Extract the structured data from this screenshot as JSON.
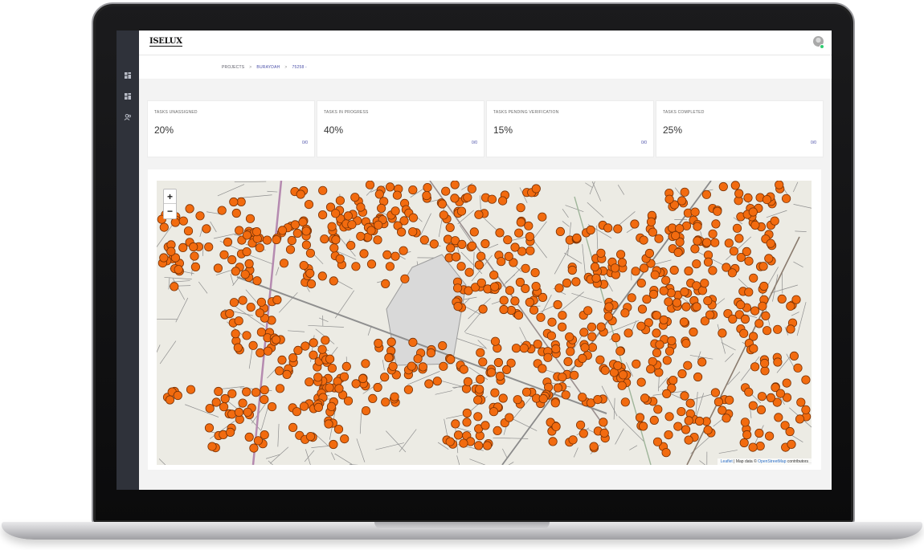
{
  "header": {
    "logo": "ISELUX"
  },
  "sidebar": {
    "icons": [
      "dashboard-icon",
      "projects-icon",
      "users-icon"
    ]
  },
  "breadcrumb": {
    "items": [
      "PROJECTS",
      "BURAYDAH",
      "75258 -"
    ],
    "separator": ">"
  },
  "stats": [
    {
      "label": "TASKS UNASSIGNED",
      "value": "20%",
      "ratio": "0/0"
    },
    {
      "label": "TASKS IN PROGRESS",
      "value": "40%",
      "ratio": "0/0"
    },
    {
      "label": "TASKS PENDING VERIFICATION",
      "value": "15%",
      "ratio": "0/0"
    },
    {
      "label": "TASKS COMPLETED",
      "value": "25%",
      "ratio": "0/0"
    }
  ],
  "map": {
    "zoom_in": "+",
    "zoom_out": "−",
    "attribution_leaflet": "Leaflet",
    "attribution_text": " | Map data © ",
    "attribution_osm": "OpenStreetMap",
    "attribution_suffix": " contributors",
    "marker_color": "#f26b0f",
    "marker_stroke": "#7a3306"
  }
}
